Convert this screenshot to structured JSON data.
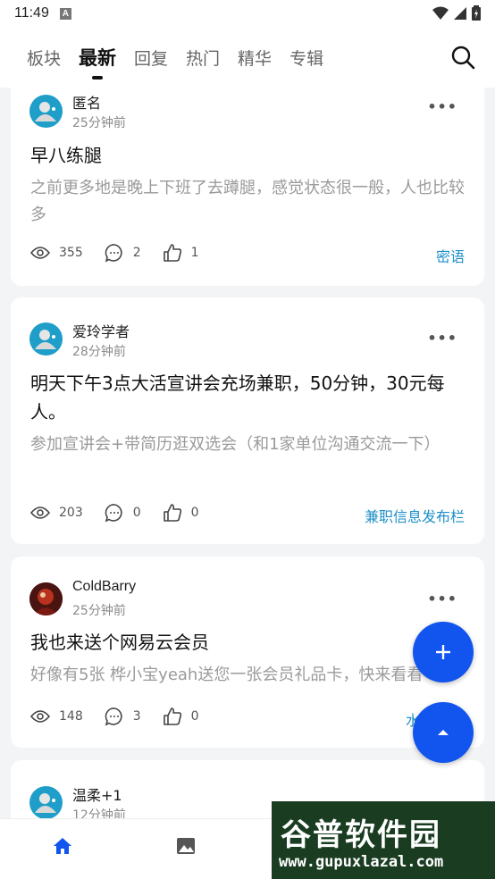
{
  "status_bar": {
    "time": "11:49",
    "badge": "A"
  },
  "nav": {
    "tabs": [
      {
        "label": "板块"
      },
      {
        "label": "最新"
      },
      {
        "label": "回复"
      },
      {
        "label": "热门"
      },
      {
        "label": "精华"
      },
      {
        "label": "专辑"
      }
    ],
    "active_tab": "最新"
  },
  "posts": [
    {
      "author": "匿名",
      "time": "25分钟前",
      "title": "早八练腿",
      "excerpt": "之前更多地是晚上下班了去蹲腿，感觉状态很一般，人也比较多",
      "views": "355",
      "comments": "2",
      "likes": "1",
      "tag": "密语",
      "more": "•••"
    },
    {
      "author": "爱玲学者",
      "time": "28分钟前",
      "title": "明天下午3点大活宣讲会充场兼职，50分钟，30元每人。",
      "excerpt": "参加宣讲会+带简历逛双选会（和1家单位沟通交流一下）",
      "views": "203",
      "comments": "0",
      "likes": "0",
      "tag": "兼职信息发布栏",
      "more": "•••"
    },
    {
      "author": "ColdBarry",
      "time": "25分钟前",
      "title": "我也来送个网易云会员",
      "excerpt": "好像有5张  桦小宝yeah送您一张会员礼品卡，快来看看",
      "views": "148",
      "comments": "3",
      "likes": "0",
      "tag": "水",
      "more": "•••"
    },
    {
      "author": "温柔+1",
      "time": "12分钟前",
      "more": "•••"
    }
  ],
  "watermark": {
    "title": "谷普软件园",
    "url": "www.gupuxlazal.com"
  },
  "colors": {
    "accent": "#1155ee",
    "tag": "#1e8fc8",
    "background": "#f3f4f6"
  }
}
